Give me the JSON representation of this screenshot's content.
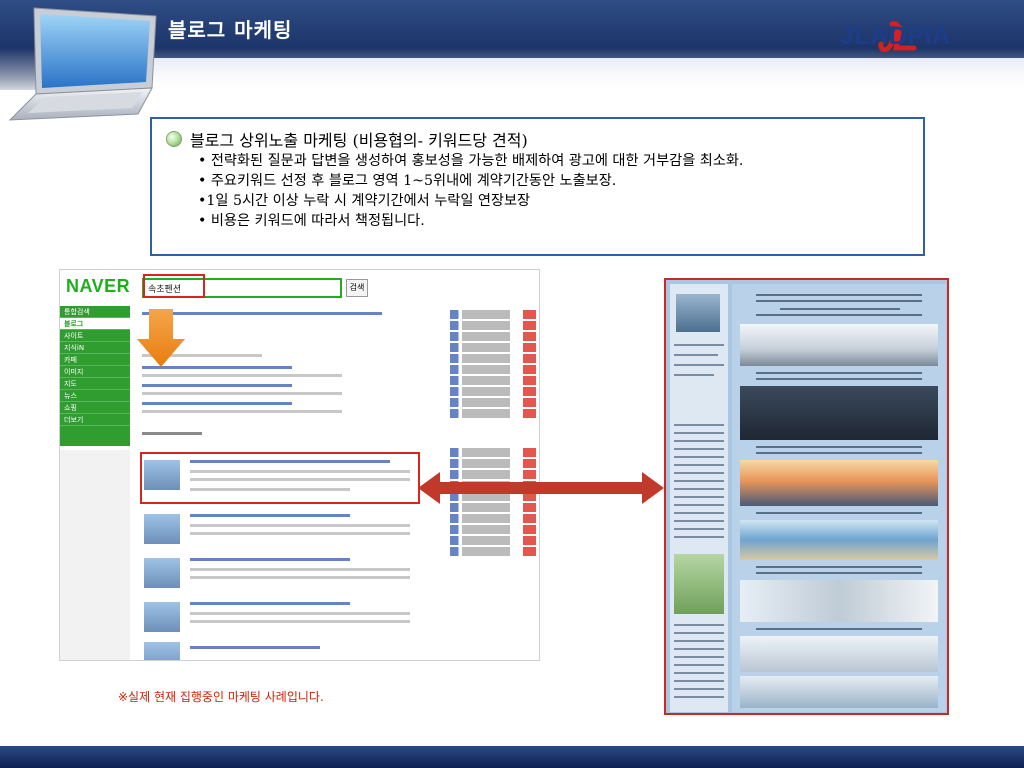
{
  "header": {
    "title": "블로그 마케팅",
    "logo_text": "JLADPIA"
  },
  "info": {
    "heading": "블로그 상위노출 마케팅 (비용협의- 키워드당 견적)",
    "items": [
      "• 전략화된 질문과 답변을 생성하여 홍보성을 가능한 배제하여 광고에 대한 거부감을 최소화.",
      "• 주요키워드 선정 후 블로그 영역 1~5위내에 계약기간동안 노출보장.",
      "•1일 5시간 이상 누락 시 계약기간에서 누락일 연장보장",
      "• 비용은 키워드에 따라서 책정됩니다."
    ]
  },
  "naver": {
    "logo": "NAVER",
    "query": "속초펜션",
    "search_button": "검색",
    "side_items": [
      "통합검색",
      "블로그",
      "사이트",
      "지식iN",
      "카페",
      "이미지",
      "지도",
      "뉴스",
      "쇼핑",
      "더보기"
    ]
  },
  "caption": "※실제 현재 집행중인 마케팅 사례입니다.",
  "colors": {
    "header_bg": "#1c3468",
    "accent_red": "#d9251c",
    "naver_green": "#1eae1e",
    "box_border": "#2f5fa6",
    "caption": "#cc2200"
  }
}
